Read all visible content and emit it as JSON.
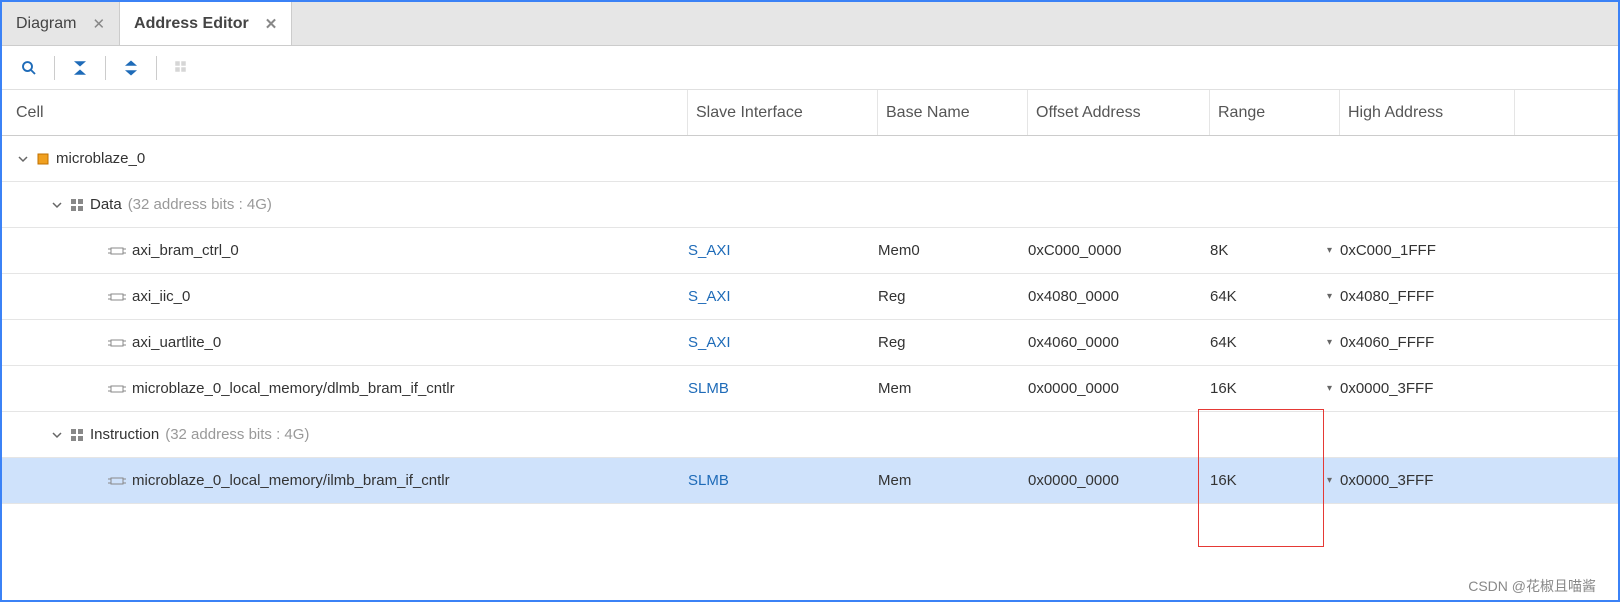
{
  "tabs": [
    {
      "label": "Diagram",
      "active": false
    },
    {
      "label": "Address Editor",
      "active": true
    }
  ],
  "columns": {
    "cell": "Cell",
    "slave_if": "Slave Interface",
    "base_name": "Base Name",
    "offset": "Offset Address",
    "range": "Range",
    "high": "High Address"
  },
  "tree": {
    "root": "microblaze_0",
    "groups": [
      {
        "label": "Data",
        "suffix": "(32 address bits : 4G)",
        "rows": [
          {
            "cell": "axi_bram_ctrl_0",
            "slave": "S_AXI",
            "base": "Mem0",
            "offset": "0xC000_0000",
            "range": "8K",
            "high": "0xC000_1FFF"
          },
          {
            "cell": "axi_iic_0",
            "slave": "S_AXI",
            "base": "Reg",
            "offset": "0x4080_0000",
            "range": "64K",
            "high": "0x4080_FFFF"
          },
          {
            "cell": "axi_uartlite_0",
            "slave": "S_AXI",
            "base": "Reg",
            "offset": "0x4060_0000",
            "range": "64K",
            "high": "0x4060_FFFF"
          },
          {
            "cell": "microblaze_0_local_memory/dlmb_bram_if_cntlr",
            "slave": "SLMB",
            "base": "Mem",
            "offset": "0x0000_0000",
            "range": "16K",
            "high": "0x0000_3FFF"
          }
        ]
      },
      {
        "label": "Instruction",
        "suffix": "(32 address bits : 4G)",
        "rows": [
          {
            "cell": "microblaze_0_local_memory/ilmb_bram_if_cntlr",
            "slave": "SLMB",
            "base": "Mem",
            "offset": "0x0000_0000",
            "range": "16K",
            "high": "0x0000_3FFF",
            "selected": true
          }
        ]
      }
    ]
  },
  "watermark": "CSDN @花椒且喵酱"
}
